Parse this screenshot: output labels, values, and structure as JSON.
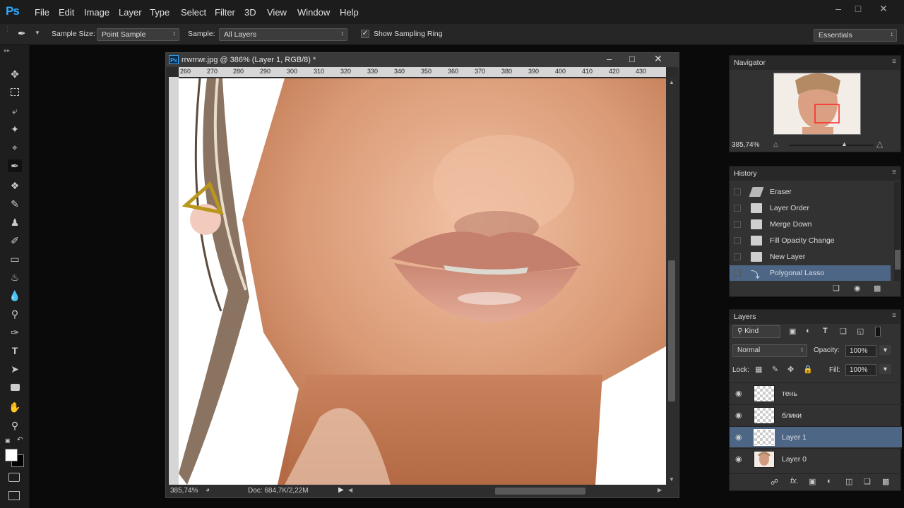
{
  "app": {
    "logo": "Ps"
  },
  "menu": [
    "File",
    "Edit",
    "Image",
    "Layer",
    "Type",
    "Select",
    "Filter",
    "3D",
    "View",
    "Window",
    "Help"
  ],
  "options": {
    "sample_size_label": "Sample Size:",
    "sample_size_value": "Point Sample",
    "sample_label": "Sample:",
    "sample_value": "All Layers",
    "sampling_ring_label": "Show Sampling Ring",
    "sampling_ring_checked": true,
    "workspace": "Essentials"
  },
  "document": {
    "title": "rrwrrwr.jpg @ 386% (Layer 1, RGB/8) *",
    "ruler_ticks": [
      "260",
      "270",
      "280",
      "290",
      "300",
      "310",
      "320",
      "330",
      "340",
      "350",
      "360",
      "370",
      "380",
      "390",
      "400",
      "410",
      "420",
      "430"
    ],
    "zoom": "385,74%",
    "doc_info": "Doc: 684,7K/2,22M"
  },
  "navigator": {
    "title": "Navigator",
    "zoom": "385,74%"
  },
  "history": {
    "title": "History",
    "items": [
      {
        "label": "Eraser",
        "icon": "eraser-icon"
      },
      {
        "label": "Layer Order",
        "icon": "document-icon"
      },
      {
        "label": "Merge Down",
        "icon": "document-icon"
      },
      {
        "label": "Fill Opacity Change",
        "icon": "document-icon"
      },
      {
        "label": "New Layer",
        "icon": "document-icon"
      },
      {
        "label": "Polygonal Lasso",
        "icon": "polygonal-lasso-icon"
      }
    ],
    "selected_index": 5
  },
  "layers": {
    "title": "Layers",
    "kind_label": "Kind",
    "blend_mode": "Normal",
    "opacity_label": "Opacity:",
    "opacity_value": "100%",
    "lock_label": "Lock:",
    "fill_label": "Fill:",
    "fill_value": "100%",
    "items": [
      {
        "name": "тень",
        "visible": true
      },
      {
        "name": "блики",
        "visible": true
      },
      {
        "name": "Layer 1",
        "visible": true
      },
      {
        "name": "Layer 0",
        "visible": true
      }
    ],
    "selected_index": 2
  },
  "colors": {
    "accent": "#31a8ff",
    "selection": "#4d6686"
  }
}
